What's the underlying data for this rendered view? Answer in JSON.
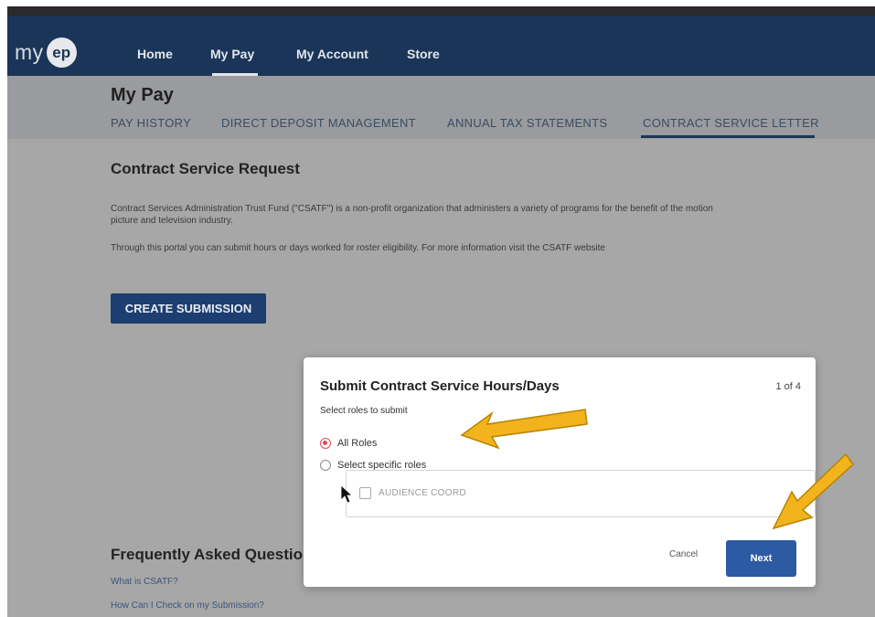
{
  "brand": {
    "prefix": "my",
    "badge": "ep"
  },
  "nav": {
    "items": [
      "Home",
      "My Pay",
      "My Account",
      "Store"
    ]
  },
  "page": {
    "title": "My Pay",
    "tabs": [
      "PAY HISTORY",
      "DIRECT DEPOSIT MANAGEMENT",
      "ANNUAL TAX STATEMENTS",
      "CONTRACT SERVICE LETTER"
    ]
  },
  "request": {
    "title": "Contract Service Request",
    "paragraph1": "Contract Services Administration Trust Fund (\"CSATF\") is a non-profit organization that administers a variety of programs for the benefit of the motion picture and television industry.",
    "paragraph2": "Through this portal you can submit hours or days worked for roster eligibility. For more information visit the CSATF website",
    "create_button": "CREATE SUBMISSION"
  },
  "faq": {
    "title": "Frequently Asked Questions",
    "links": [
      "What is CSATF?",
      "How Can I Check on my Submission?"
    ]
  },
  "modal": {
    "title": "Submit Contract Service Hours/Days",
    "step": "1 of 4",
    "prompt": "Select roles to submit",
    "option_all": "All Roles",
    "option_specific": "Select specific roles",
    "role_item": "AUDIENCE COORD",
    "cancel": "Cancel",
    "next": "Next"
  },
  "colors": {
    "nav": "#1a3557",
    "primary_button": "#2c5aa3",
    "radio_selected": "#e04b5a",
    "annotation_arrow": "#f2b31c"
  }
}
